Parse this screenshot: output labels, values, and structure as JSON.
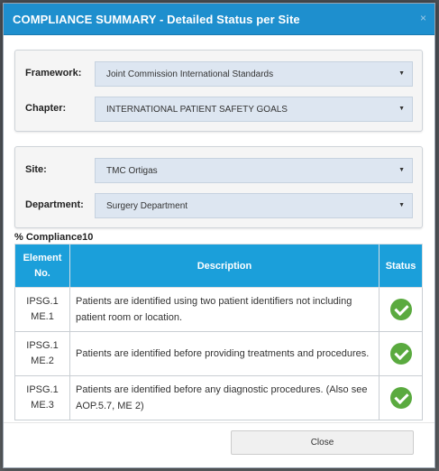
{
  "dialog": {
    "title": "COMPLIANCE SUMMARY - Detailed Status per Site",
    "close_icon": "×"
  },
  "filters_top": {
    "framework_label": "Framework:",
    "framework_value": "Joint Commission International Standards",
    "chapter_label": "Chapter:",
    "chapter_value": "INTERNATIONAL PATIENT SAFETY GOALS"
  },
  "filters_bottom": {
    "site_label": "Site:",
    "site_value": "TMC Ortigas",
    "department_label": "Department:",
    "department_value": "Surgery Department"
  },
  "compliance_label": "% Compliance10",
  "table": {
    "headers": {
      "element_line1": "Element",
      "element_line2": "No.",
      "description": "Description",
      "status": "Status"
    },
    "rows": [
      {
        "element_line1": "IPSG.1",
        "element_line2": "ME.1",
        "description": "Patients are identified using two patient identifiers not including patient room or location.",
        "status_icon": "check-circle-icon"
      },
      {
        "element_line1": "IPSG.1",
        "element_line2": "ME.2",
        "description": "Patients are identified before providing treatments and procedures.",
        "status_icon": "check-circle-icon"
      },
      {
        "element_line1": "IPSG.1",
        "element_line2": "ME.3",
        "description": "Patients are identified before any diagnostic procedures. (Also see AOP.5.7, ME 2)",
        "status_icon": "check-circle-icon"
      }
    ]
  },
  "footer": {
    "close_label": "Close"
  },
  "colors": {
    "header_bg": "#1e8fce",
    "table_header_bg": "#1b9fda",
    "select_bg": "#dde6f1",
    "status_ok": "#5aaa3f"
  }
}
